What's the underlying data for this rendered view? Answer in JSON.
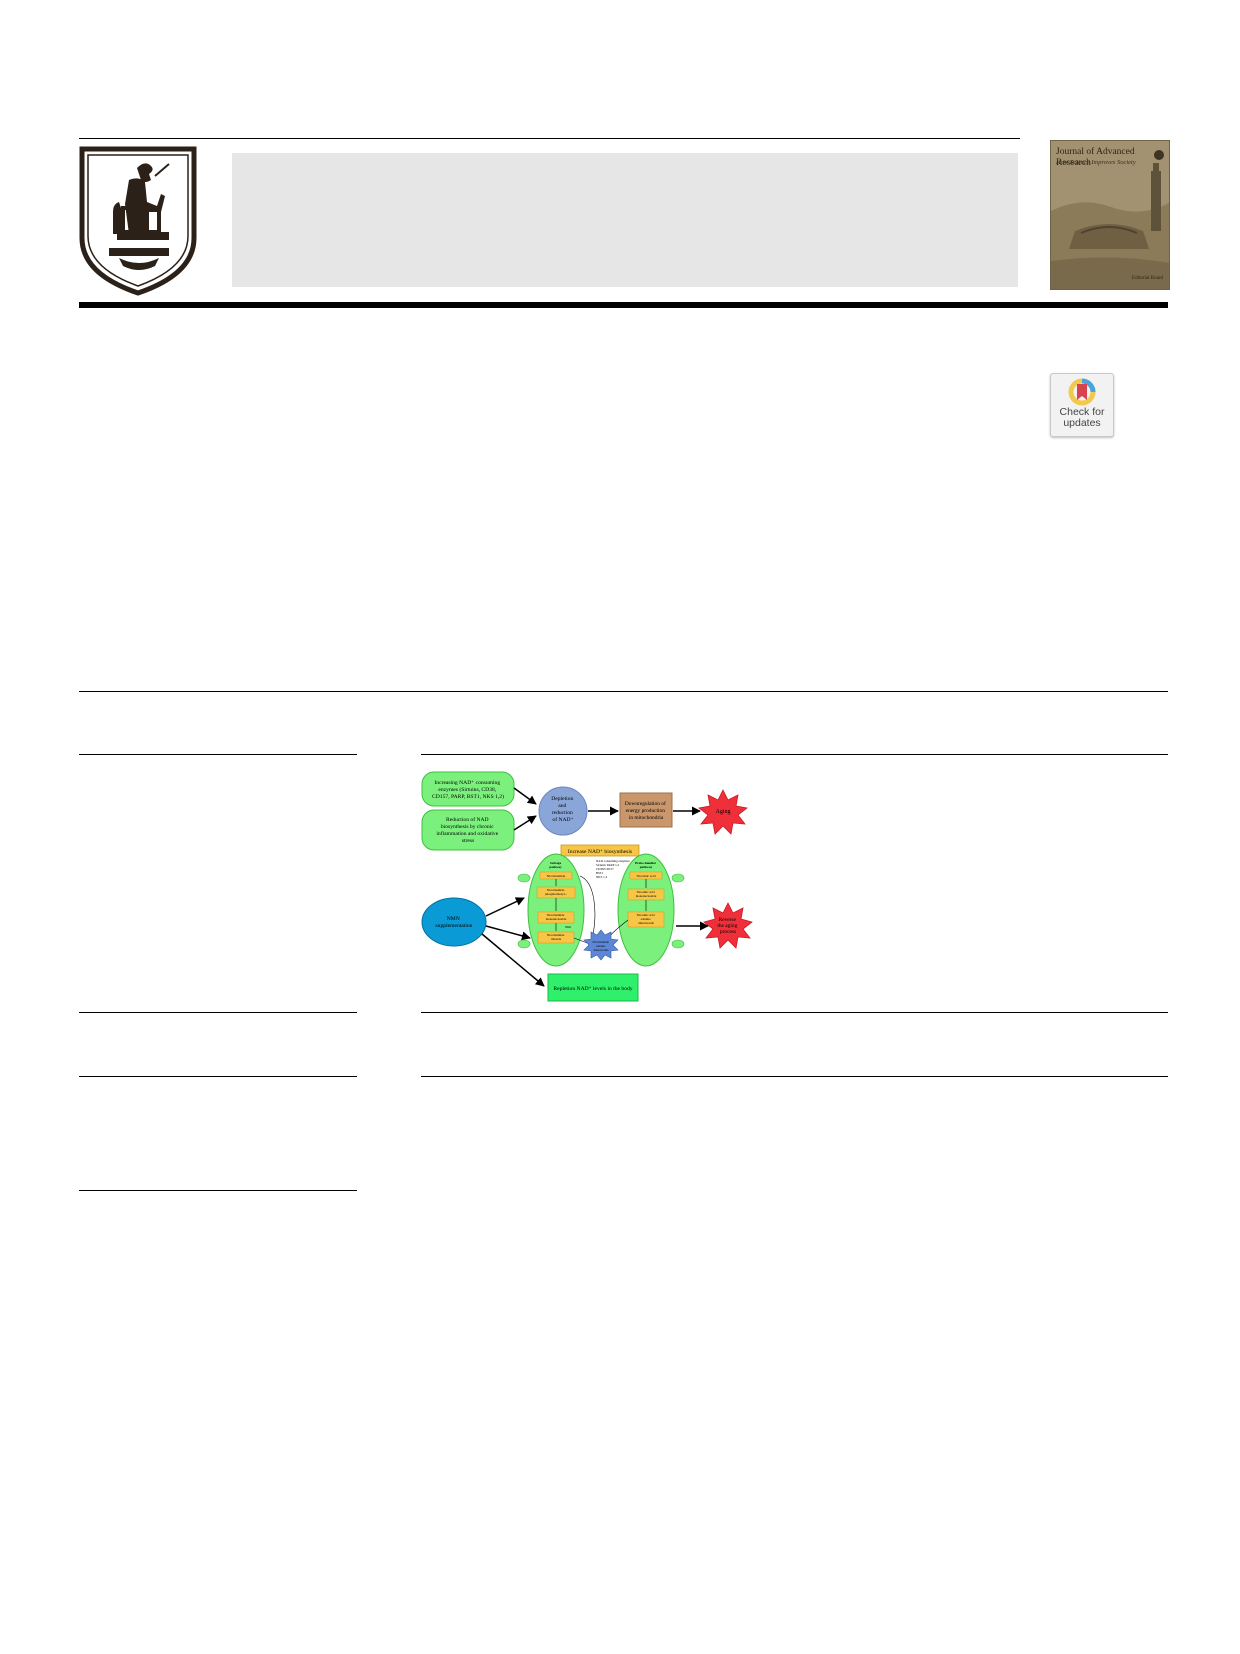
{
  "journal": {
    "cover_title": "Journal of Advanced Research",
    "cover_subtitle": "How Science Improves Society",
    "cover_footer": "Editorial Board"
  },
  "badge": {
    "line1": "Check for",
    "line2": "updates"
  },
  "graphical_abstract": {
    "boxes": {
      "consuming_enzymes": [
        "Increasing NAD⁺ consuming",
        "enzymes (Sirtuins, CD38,",
        "CD157, PARP, BST1, NKS 1,2)"
      ],
      "reduction": [
        "Reduction of NAD",
        "biosynthesis by chronic",
        "inflammation and oxidative",
        "stress"
      ],
      "depletion": [
        "Depletion",
        "and",
        "reduction",
        "of NAD⁺"
      ],
      "downregulation": [
        "Downregulation of",
        "energy production",
        "in mitochondria"
      ],
      "aging": "Aging",
      "increase_biosynthesis": "Increase NAD⁺ biosynthesis",
      "nmn_supplementation": [
        "NMN",
        "supplementation"
      ],
      "reverse": [
        "Reverse",
        "the aging",
        "process"
      ],
      "repletion": "Repletion NAD⁺ levels in the body",
      "salvage_pathway": [
        "Salvage",
        "pathway"
      ],
      "preiss_handler": [
        "Preiss-handler",
        "pathway"
      ],
      "nicotinamide": "Nicotinamide",
      "nampt": [
        "Nicotinamide",
        "phosphoribosyl..."
      ],
      "nmn": [
        "Nicotinamide",
        "mononucleotide"
      ],
      "nmn_riboside": [
        "Nicotinamide",
        "riboside"
      ],
      "nicotinic_acid": "Nicotinic acid",
      "nicotinic_mono": [
        "Nicotinic acid",
        "mononucleotide"
      ],
      "nicotinic_dinuc": [
        "Nicotinic acid",
        "adenine",
        "dinucleotide"
      ],
      "nad_center": [
        "Nicotinamide",
        "adenine",
        "dinucleotide"
      ],
      "consuming_note": [
        "NAD consuming enzymes",
        "Sirtuins PARP 1,2",
        "CD38/CD157",
        "BST1",
        "NKS 1,2"
      ],
      "nrk": "NRK"
    }
  }
}
